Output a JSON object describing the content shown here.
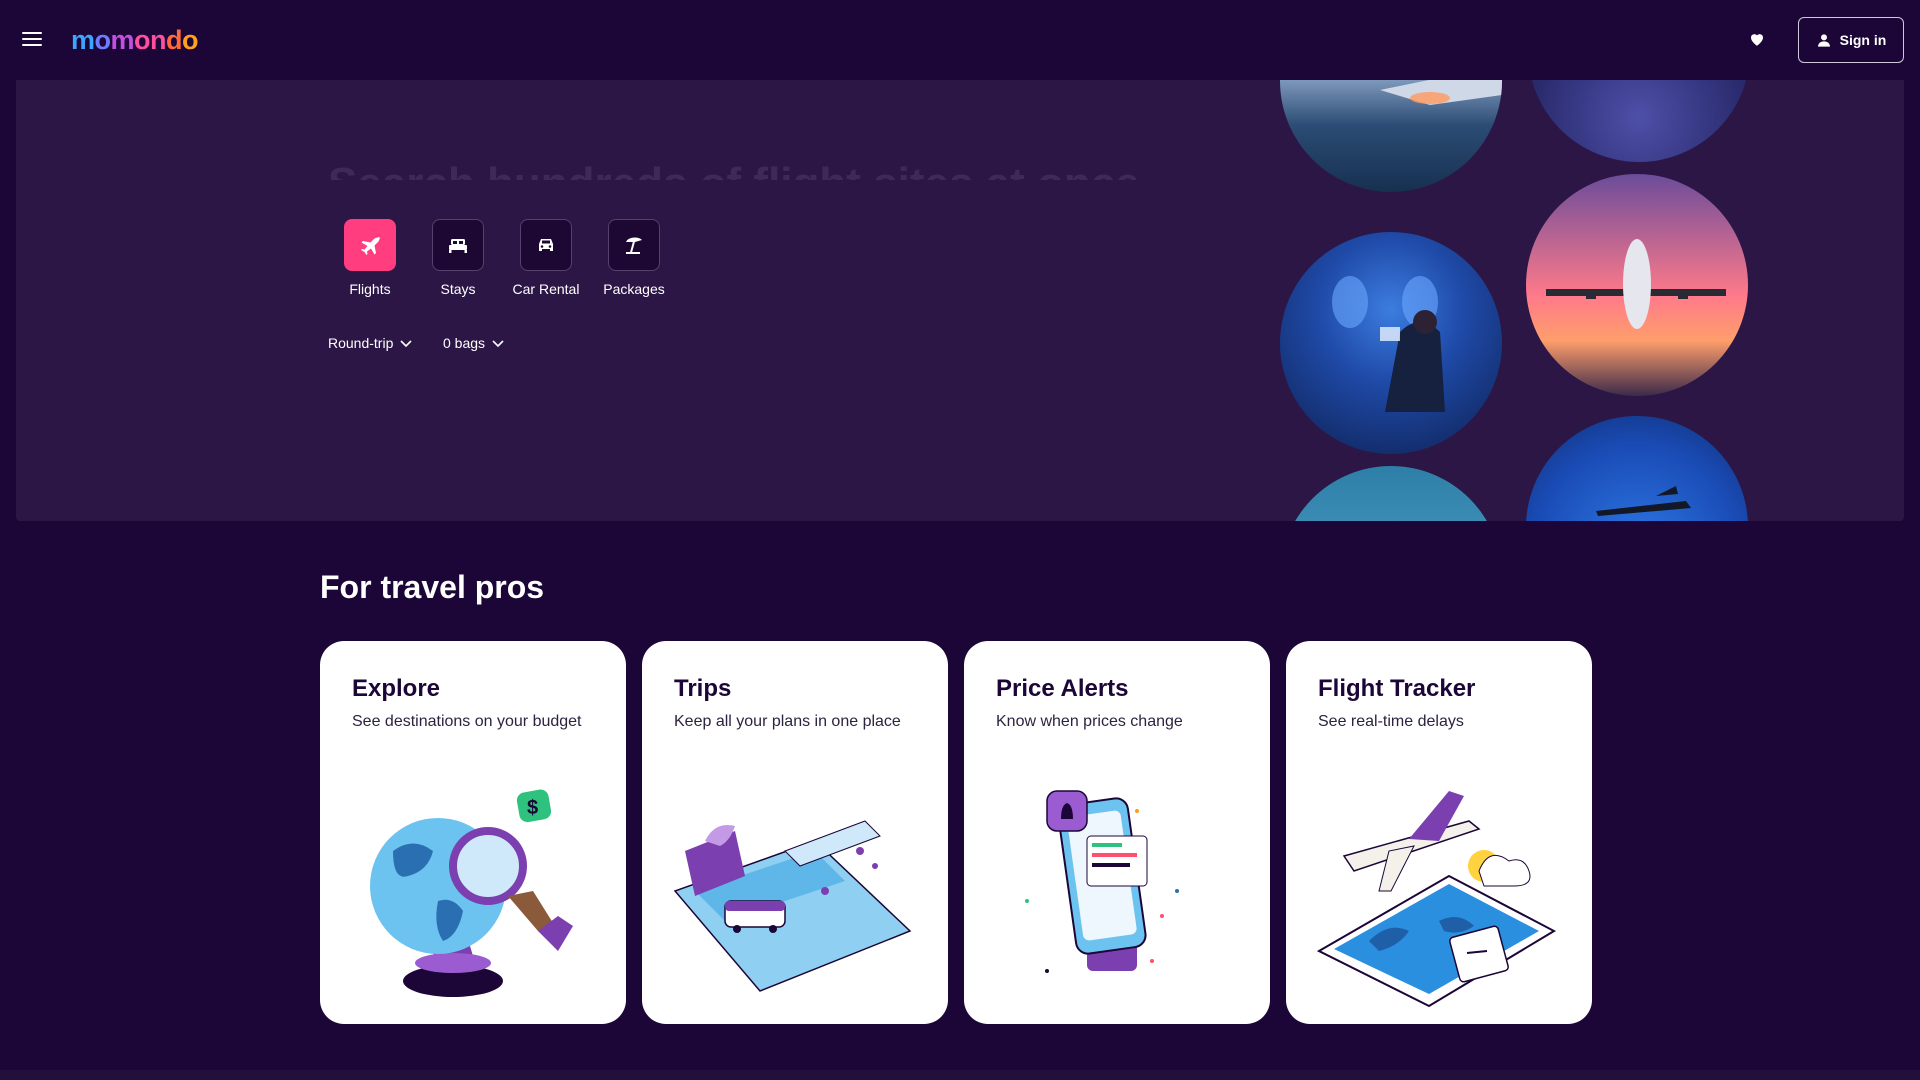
{
  "header": {
    "logo": [
      "mo",
      "mo",
      "n",
      "d",
      "o"
    ],
    "signin_label": "Sign in"
  },
  "hero": {
    "headline": "Search hundreds of flight sites at once.",
    "verticals": [
      {
        "label": "Flights",
        "icon": "plane-icon",
        "active": true
      },
      {
        "label": "Stays",
        "icon": "bed-icon",
        "active": false
      },
      {
        "label": "Car Rental",
        "icon": "car-icon",
        "active": false
      },
      {
        "label": "Packages",
        "icon": "umbrella-icon",
        "active": false
      }
    ],
    "trip_type": "Round-trip",
    "bags": "0 bags"
  },
  "pros": {
    "title": "For travel pros",
    "cards": [
      {
        "title": "Explore",
        "subtitle": "See destinations on your budget"
      },
      {
        "title": "Trips",
        "subtitle": "Keep all your plans in one place"
      },
      {
        "title": "Price Alerts",
        "subtitle": "Know when prices change"
      },
      {
        "title": "Flight Tracker",
        "subtitle": "See real-time delays"
      }
    ]
  },
  "colors": {
    "background": "#1b0637",
    "hero": "#2c1646",
    "accent": "#ff3d7f"
  }
}
